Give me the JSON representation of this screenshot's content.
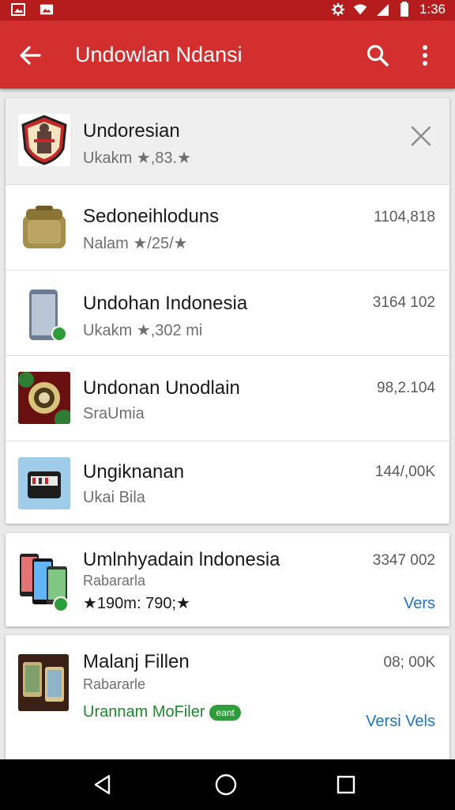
{
  "status_bar": {
    "time": "1:36"
  },
  "app_bar": {
    "title": "Undowlan Ndansi"
  },
  "items": [
    {
      "title": "Undoresian",
      "subtitle": "Ukakm ★,83.★",
      "meta": ""
    },
    {
      "title": "Sedoneihloduns",
      "subtitle": "Nalam ★/25/★",
      "meta": "1104,818"
    },
    {
      "title": "Undohan Indonesia",
      "subtitle": "Ukakm ★,302 mi",
      "meta": "3164 102"
    },
    {
      "title": "Undonan Unodlain",
      "subtitle": "SraUmia",
      "meta": "98,2.104"
    },
    {
      "title": "Ungiknanan",
      "subtitle": "Ukai Bila",
      "meta": "144/,00K"
    },
    {
      "title": "Umlnhyadain lndonesia",
      "subtitle": "Rabararla",
      "line3": "★190m: 790;★",
      "meta": "3347 002",
      "action": "Vers"
    },
    {
      "title": "Malanj Fillen",
      "subtitle": "Rabararle",
      "line3": "Urannam MoFiler",
      "pill": "eant",
      "meta": "08; 00K",
      "action": "Versi Vels"
    }
  ],
  "colors": {
    "primary": "#d32f2f",
    "status_bar": "#b71c1c",
    "accent": "#1e73be",
    "green": "#2e9e3a"
  },
  "icons": [
    "gallery-icon",
    "photo-icon",
    "settings-icon",
    "wifi-icon",
    "signal-icon",
    "battery-icon",
    "back-arrow-icon",
    "search-icon",
    "more-vert-icon",
    "close-icon",
    "nav-back-icon",
    "nav-home-icon",
    "nav-recents-icon"
  ]
}
